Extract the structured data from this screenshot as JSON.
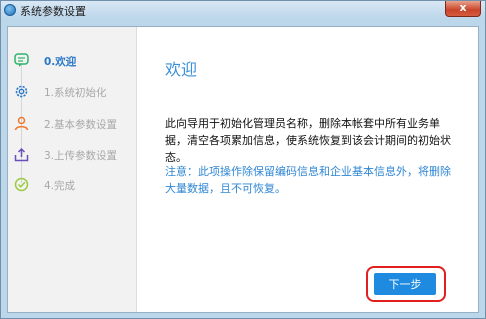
{
  "window": {
    "title": "系统参数设置",
    "close_label": "x"
  },
  "steps": [
    {
      "label": "0.欢迎",
      "icon": "chat-bubble-icon",
      "active": true
    },
    {
      "label": "1.系统初始化",
      "icon": "gear-icon",
      "active": false
    },
    {
      "label": "2.基本参数设置",
      "icon": "user-icon",
      "active": false
    },
    {
      "label": "3.上传参数设置",
      "icon": "upload-icon",
      "active": false
    },
    {
      "label": "4.完成",
      "icon": "check-circle-icon",
      "active": false
    }
  ],
  "content": {
    "heading": "欢迎",
    "description": "此向导用于初始化管理员名称，删除本帐套中所有业务单据，清空各项累加信息，使系统恢复到该会计期间的初始状态。",
    "notice": "注意：此项操作除保留编码信息和企业基本信息外，将删除大量数据，且不可恢复。"
  },
  "buttons": {
    "next_label": "下一步"
  },
  "colors": {
    "accent": "#2a78c8",
    "heading": "#3a90d8",
    "notice": "#2f86d4",
    "button": "#1e8be0",
    "highlight": "#e02020",
    "step_active_icon": "#2db36a",
    "step_orange_icon": "#f0782a"
  }
}
